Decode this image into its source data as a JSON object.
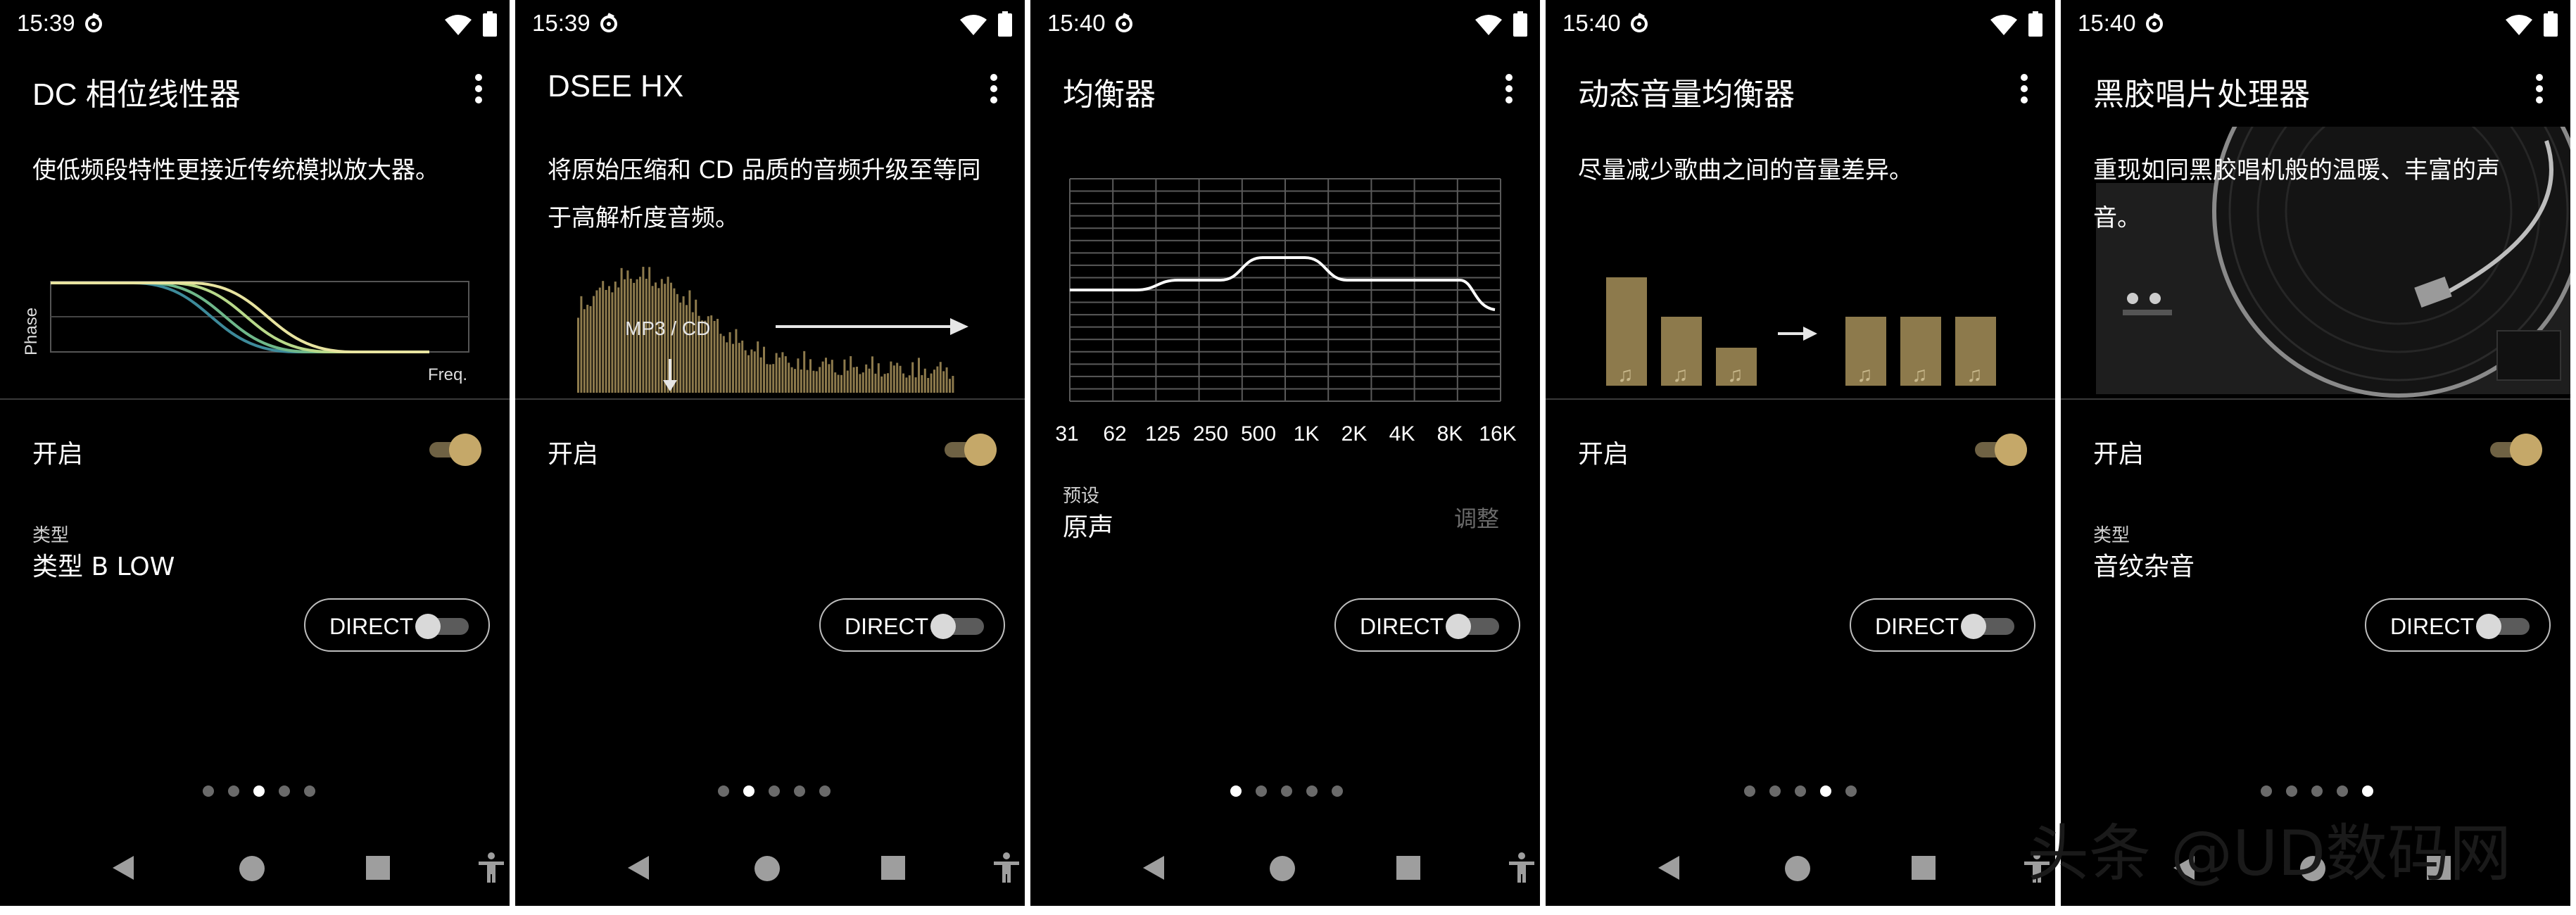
{
  "common": {
    "on_label": "开启",
    "direct_label": "DIRECT",
    "status_icons": [
      "app-notification-icon",
      "wifi-icon",
      "battery-icon"
    ],
    "accent_color": "#c5a869"
  },
  "panels": [
    {
      "time": "15:39",
      "title": "DC 相位线性器",
      "description": "使低频段特性更接近传统模拟放大器。",
      "illustration": {
        "y_label": "Phase",
        "x_label": "Freq."
      },
      "type_label": "类型",
      "type_value": "类型 B LOW",
      "page_active": 3
    },
    {
      "time": "15:39",
      "title": "DSEE HX",
      "description": "将原始压缩和 CD 品质的音频升级至等同于高解析度音频。",
      "illustration": {
        "label": "MP3 / CD"
      },
      "page_active": 2
    },
    {
      "time": "15:40",
      "title": "均衡器",
      "eq_bands": [
        "31",
        "62",
        "125",
        "250",
        "500",
        "1K",
        "2K",
        "4K",
        "8K",
        "16K"
      ],
      "preset_label": "预设",
      "preset_value": "原声",
      "adjust_label": "调整",
      "page_active": 1
    },
    {
      "time": "15:40",
      "title": "动态音量均衡器",
      "description": "尽量减少歌曲之间的音量差异。",
      "page_active": 4
    },
    {
      "time": "15:40",
      "title": "黑胶唱片处理器",
      "description": "重现如同黑胶唱机般的温暖、丰富的声音。",
      "type_label": "类型",
      "type_value": "音纹杂音",
      "page_active": 5
    }
  ],
  "watermark": "头条 @UD数码网"
}
